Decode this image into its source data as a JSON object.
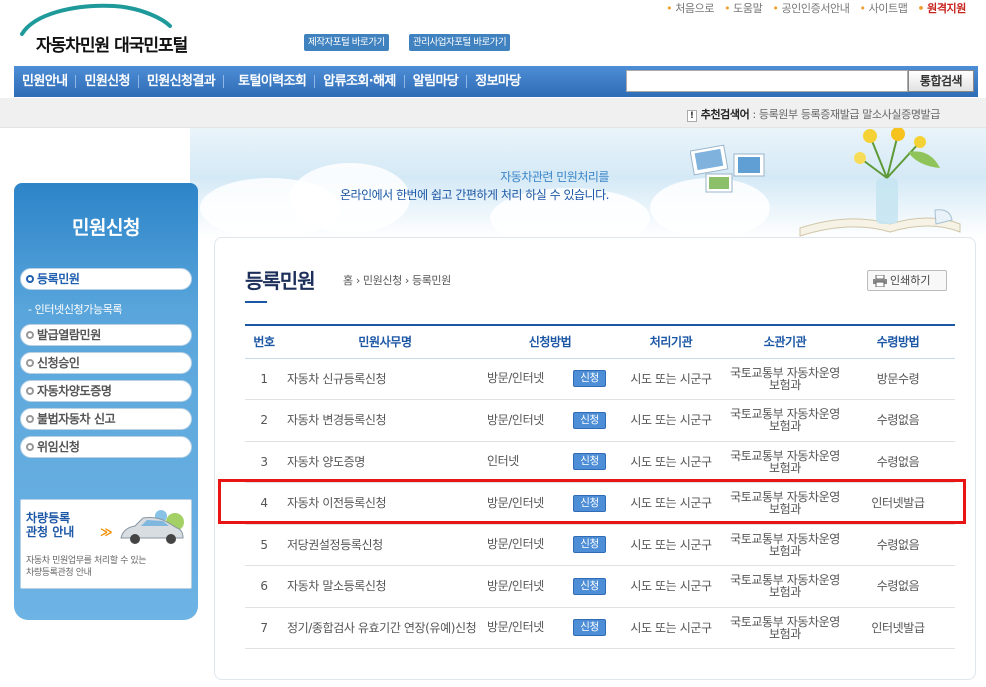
{
  "header": {
    "logo_text": "자동차민원 대국민포털",
    "portal_links": [
      "제작자포털 바로가기",
      "관리사업자포털 바로가기"
    ],
    "util_links": [
      "처음으로",
      "도움말",
      "공인인증서안내",
      "사이트맵",
      "원격지원"
    ]
  },
  "nav": {
    "items": [
      "민원안내",
      "민원신청",
      "민원신청결과",
      "토털이력조회",
      "압류조회·해제",
      "알림마당",
      "정보마당"
    ],
    "search_placeholder": "",
    "search_button": "통합검색"
  },
  "recommend": {
    "label": "추천검색어",
    "separator": " : ",
    "keywords": "등록원부  등록증재발급  말소사실증명발급"
  },
  "banner": {
    "line1": "자동차관련 민원처리를",
    "line2": "온라인에서 한번에 쉽고 간편하게 처리 하실 수 있습니다."
  },
  "sidebar": {
    "title": "민원신청",
    "items": [
      "등록민원",
      "발급열람민원",
      "신청승인",
      "자동차양도증명",
      "불법자동차 신고",
      "위임신청"
    ],
    "sub_item": "- 인터넷신청가능목록",
    "promo": {
      "title_line1": "차량등록",
      "title_line2": "관청 안내",
      "arrow": "≫",
      "desc_line1": "자동차 민원업무를 처리할 수 있는",
      "desc_line2": "차량등록관청 안내"
    }
  },
  "content": {
    "title": "등록민원",
    "breadcrumb": "홈 › 민원신청 › 등록민원",
    "print_label": "인쇄하기",
    "table": {
      "headers": [
        "번호",
        "민원사무명",
        "신청방법",
        "처리기관",
        "소관기관",
        "수령방법"
      ],
      "apply_label": "신청",
      "rows": [
        {
          "no": "1",
          "name": "자동차 신규등록신청",
          "method": "방문/인터넷",
          "agency": "시도 또는 시군구",
          "owner": "국토교통부 자동차운영보험과",
          "receive": "방문수령"
        },
        {
          "no": "2",
          "name": "자동차 변경등록신청",
          "method": "방문/인터넷",
          "agency": "시도 또는 시군구",
          "owner": "국토교통부 자동차운영보험과",
          "receive": "수령없음"
        },
        {
          "no": "3",
          "name": "자동차 양도증명",
          "method": "인터넷",
          "agency": "시도 또는 시군구",
          "owner": "국토교통부 자동차운영보험과",
          "receive": "수령없음"
        },
        {
          "no": "4",
          "name": "자동차 이전등록신청",
          "method": "방문/인터넷",
          "agency": "시도 또는 시군구",
          "owner": "국토교통부 자동차운영보험과",
          "receive": "인터넷발급"
        },
        {
          "no": "5",
          "name": "저당권설정등록신청",
          "method": "방문/인터넷",
          "agency": "시도 또는 시군구",
          "owner": "국토교통부 자동차운영보험과",
          "receive": "수령없음"
        },
        {
          "no": "6",
          "name": "자동차 말소등록신청",
          "method": "방문/인터넷",
          "agency": "시도 또는 시군구",
          "owner": "국토교통부 자동차운영보험과",
          "receive": "수령없음"
        },
        {
          "no": "7",
          "name": "정기/종합검사 유효기간 연장(유예)신청",
          "method": "방문/인터넷",
          "agency": "시도 또는 시군구",
          "owner": "국토교통부 자동차운영보험과",
          "receive": "인터넷발급"
        }
      ]
    }
  },
  "colors": {
    "nav_blue": "#2f6cb5",
    "accent_red": "#e81515",
    "title_navy": "#1c2e5a"
  },
  "icons": [
    "car-logo-icon",
    "print-icon",
    "car-icon"
  ]
}
